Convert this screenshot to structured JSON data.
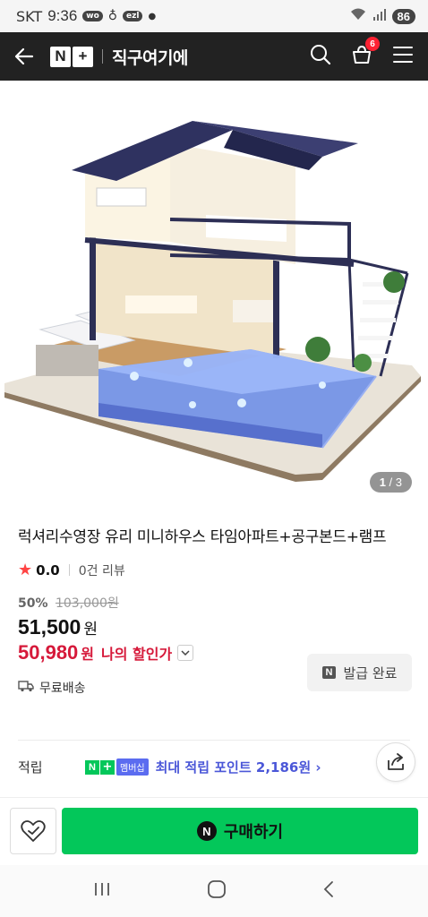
{
  "status_bar": {
    "carrier": "SKT",
    "time": "9:36",
    "notif_1": "wo",
    "notif_2": "ezl",
    "battery": "86"
  },
  "header": {
    "logo_n": "N",
    "logo_plus": "+",
    "title": "직구여기에",
    "cart_count": "6"
  },
  "gallery": {
    "current": "1",
    "total": "3"
  },
  "product": {
    "name": "럭셔리수영장 유리 미니하우스 타임아파트+공구본드+램프",
    "star": "★",
    "rating": "0.0",
    "reviews": "0건 리뷰",
    "discount_pct": "50%",
    "original_price": "103,000원",
    "price": "51,500",
    "won": "원",
    "my_price": "50,980",
    "my_won": "원",
    "my_price_label": "나의 할인가",
    "coupon_icon": "N",
    "coupon_label": "발급 완료",
    "shipping": "무료배송"
  },
  "points": {
    "label": "적립",
    "badge_n": "N",
    "badge_plus": "+",
    "badge_membership": "멤버십",
    "text": "최대 적립 포인트 2,186원 ›"
  },
  "bottom": {
    "buy_icon": "N",
    "buy_label": "구매하기"
  },
  "colors": {
    "accent_green": "#03c75a",
    "price_red": "#d6193a",
    "points_blue": "#4b57d8"
  }
}
